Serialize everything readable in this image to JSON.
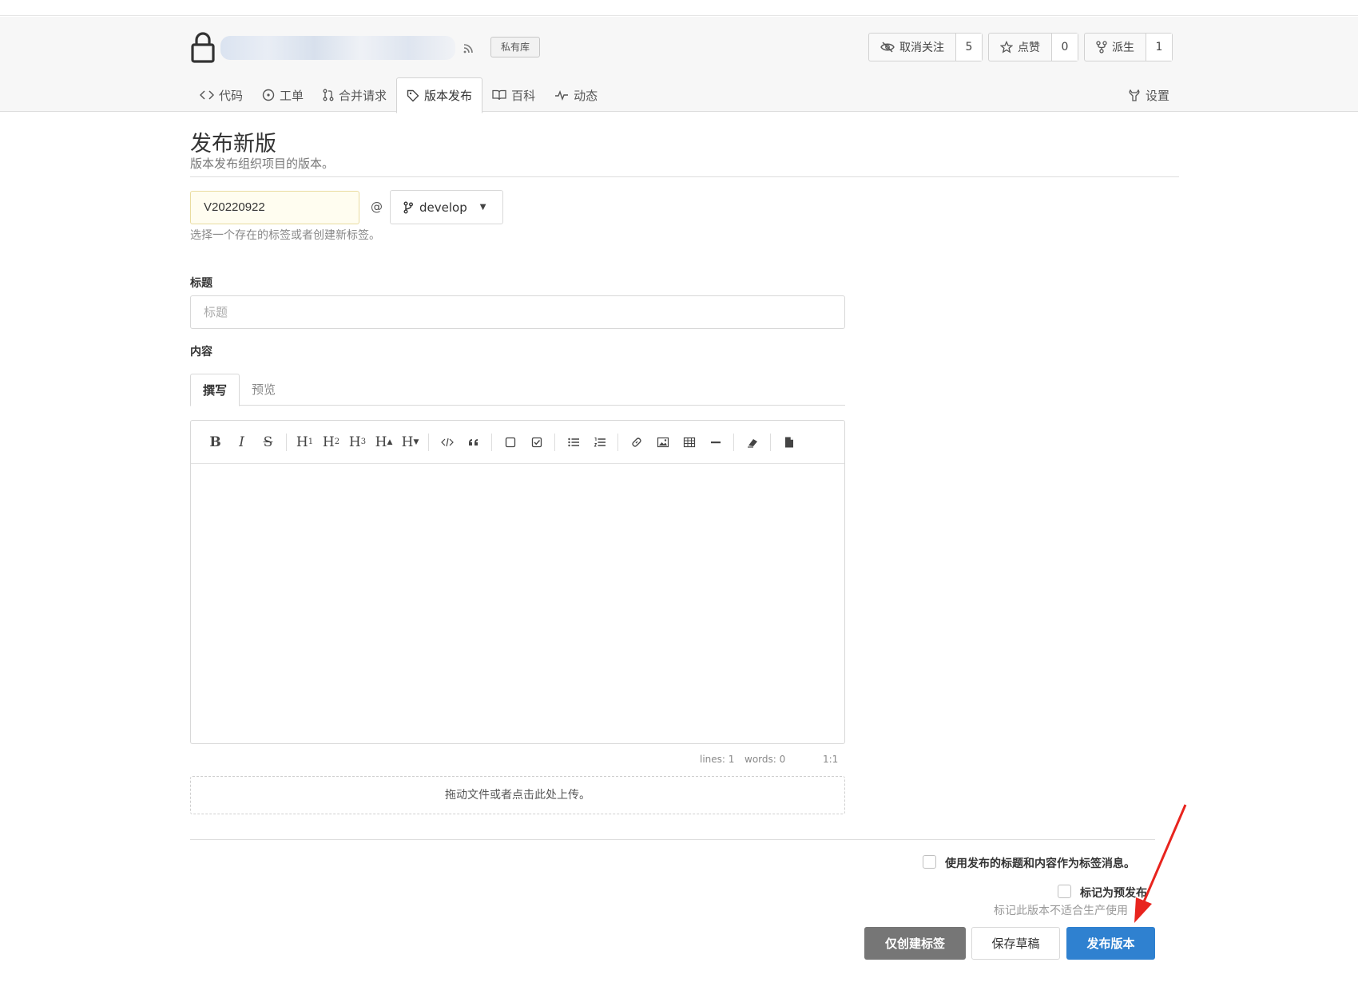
{
  "header": {
    "private_badge": "私有库",
    "watch": {
      "label": "取消关注",
      "count": "5"
    },
    "star": {
      "label": "点赞",
      "count": "0"
    },
    "fork": {
      "label": "派生",
      "count": "1"
    },
    "tabs": [
      {
        "label": "代码",
        "icon": "code-icon"
      },
      {
        "label": "工单",
        "icon": "issue-icon"
      },
      {
        "label": "合并请求",
        "icon": "pull-request-icon"
      },
      {
        "label": "版本发布",
        "icon": "tag-icon"
      },
      {
        "label": "百科",
        "icon": "book-icon"
      },
      {
        "label": "动态",
        "icon": "pulse-icon"
      }
    ],
    "settings_label": "设置"
  },
  "form": {
    "page_title": "发布新版",
    "page_subtitle": "版本发布组织项目的版本。",
    "tag_value": "V20220922",
    "at": "@",
    "branch": "develop",
    "tag_hint": "选择一个存在的标签或者创建新标签。",
    "title_label": "标题",
    "title_placeholder": "标题",
    "content_label": "内容",
    "tab_write": "撰写",
    "tab_preview": "预览",
    "status_lines": "lines: 1",
    "status_words": "words: 0",
    "status_cursor": "1:1",
    "dropzone": "拖动文件或者点击此处上传。",
    "use_title_label": "使用发布的标题和内容作为标签消息。",
    "prerelease_label": "标记为预发布",
    "prerelease_hint": "标记此版本不适合生产使用",
    "btn_tag_only": "仅创建标签",
    "btn_save_draft": "保存草稿",
    "btn_publish": "发布版本"
  },
  "colors": {
    "publish_blue": "#2f81d0",
    "tag_gray": "#767676",
    "arrow_red": "#e8241e"
  }
}
